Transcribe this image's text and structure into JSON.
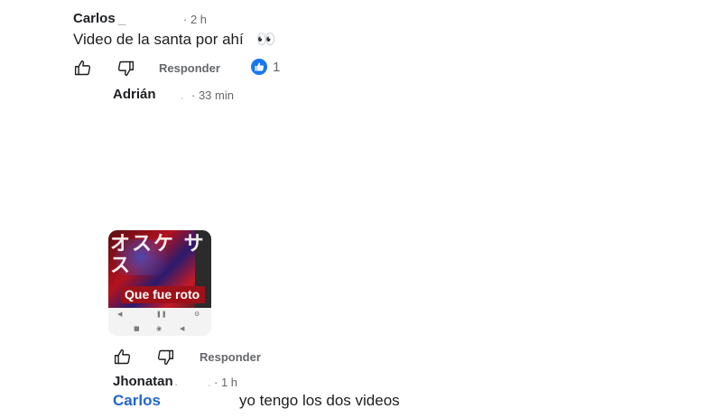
{
  "comments": [
    {
      "author": "Carlos",
      "author_suffix": "_",
      "time": "· 2 h",
      "text": "Video de la santa por ahí",
      "emoji": "👀",
      "reply_label": "Responder",
      "like_count": "1"
    },
    {
      "author": "Adrián",
      "time": "· 33 min",
      "media_caption": "Que fue roto",
      "media_overlay_text": "オスケ サス",
      "reply_label": "Responder"
    },
    {
      "author": "Jhonatan",
      "author_suffix": ".",
      "time": "· 1 h",
      "mention": "Carlos",
      "text": "yo tengo los dos videos"
    }
  ],
  "colors": {
    "mention": "#2166c8",
    "reaction": "#1877f2",
    "muted": "#65676b"
  },
  "icons": {
    "like": "thumbs-up-icon",
    "dislike": "thumbs-down-icon",
    "reaction": "like-reaction-icon"
  }
}
